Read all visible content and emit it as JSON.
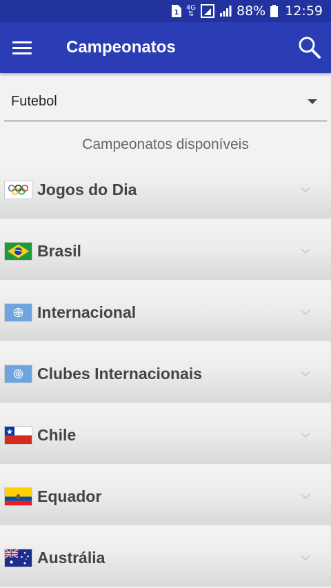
{
  "status": {
    "network": "4G",
    "battery": "88%",
    "time": "12:59"
  },
  "appbar": {
    "title": "Campeonatos"
  },
  "filter": {
    "selected": "Futebol"
  },
  "section": {
    "title": "Campeonatos disponíveis"
  },
  "championships": [
    {
      "label": "Jogos do Dia",
      "flag": "olympic-rings-icon"
    },
    {
      "label": "Brasil",
      "flag": "brazil-flag-icon"
    },
    {
      "label": "Internacional",
      "flag": "un-flag-icon"
    },
    {
      "label": "Clubes Internacionais",
      "flag": "un-flag-icon"
    },
    {
      "label": "Chile",
      "flag": "chile-flag-icon"
    },
    {
      "label": "Equador",
      "flag": "ecuador-flag-icon"
    },
    {
      "label": "Austrália",
      "flag": "australia-flag-icon"
    }
  ],
  "colors": {
    "statusbar": "#2233a0",
    "appbar": "#2a3db4"
  }
}
